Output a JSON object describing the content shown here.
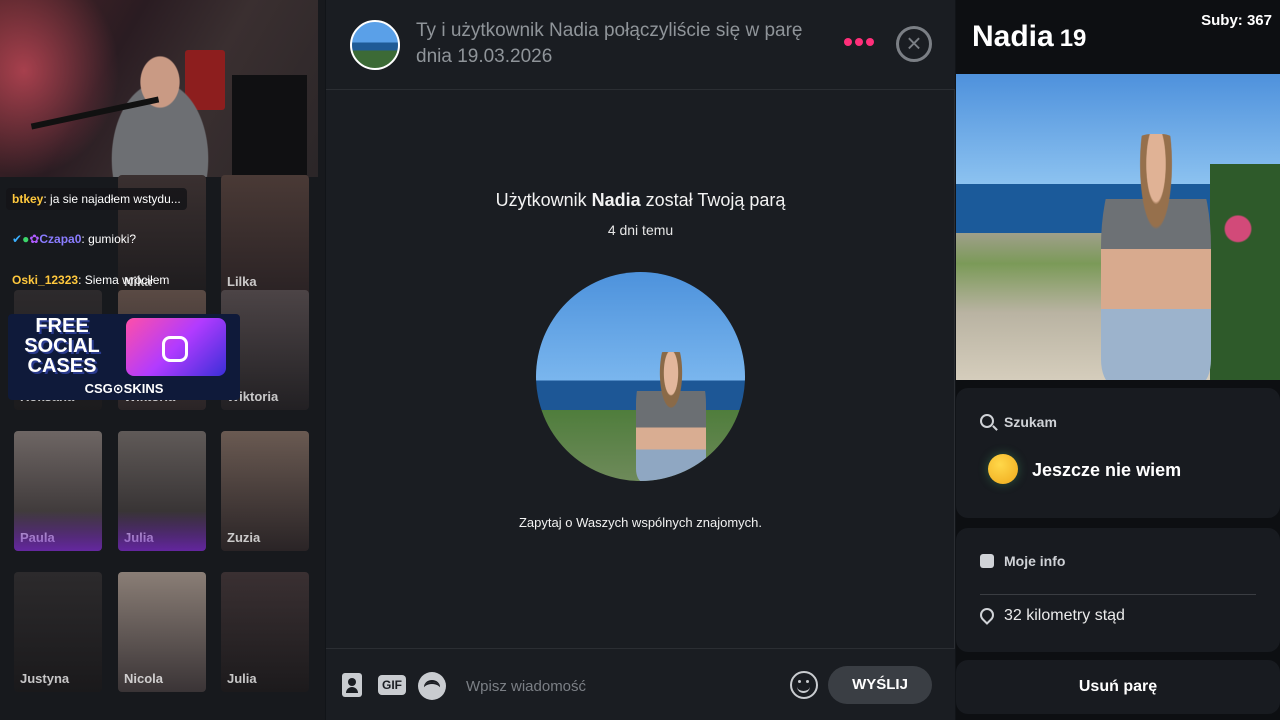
{
  "stream": {
    "chat": [
      {
        "user": "btkey",
        "text": "ja sie najadłem wstydu...",
        "color": "#ffc83d"
      },
      {
        "user": "Czapa0",
        "text": "gumioki?",
        "color": "#8a7cff"
      },
      {
        "user": "Oski_12323",
        "text": "Siema wróciłem",
        "color": "#ffc83d"
      }
    ],
    "tiles": [
      "Nika",
      "Lilka",
      "Roksana",
      "Wiktoria",
      "Wiktoria",
      "Paula",
      "Julia",
      "Zuzia",
      "Justyna",
      "Nicola",
      "Julia"
    ],
    "promo": {
      "line1": "FREE",
      "line2": "SOCIAL",
      "line3": "CASES",
      "brand": "CSG⊙SKINS"
    }
  },
  "header": {
    "text": "Ty i użytkownik Nadia połączyliście się w parę dnia 19.03.2026",
    "dots": "•••"
  },
  "match": {
    "prefix": "Użytkownik ",
    "name": "Nadia",
    "suffix": " został Twoją parą",
    "time": "4 dni temu",
    "prompt": "Zapytaj o Waszych wspólnych znajomych."
  },
  "composer": {
    "gif": "GIF",
    "placeholder": "Wpisz wiadomość",
    "send": "WYŚLIJ"
  },
  "profile": {
    "name": "Nadia",
    "age": "19",
    "subs": "Suby: 367",
    "looking_for_label": "Szukam",
    "looking_for_value": "Jeszcze nie wiem",
    "info_label": "Moje info",
    "distance": "32 kilometry stąd",
    "unmatch": "Usuń parę"
  },
  "colors": {
    "accent": "#ff2f7a",
    "background": "#1a1d22",
    "panel": "#181b20"
  }
}
